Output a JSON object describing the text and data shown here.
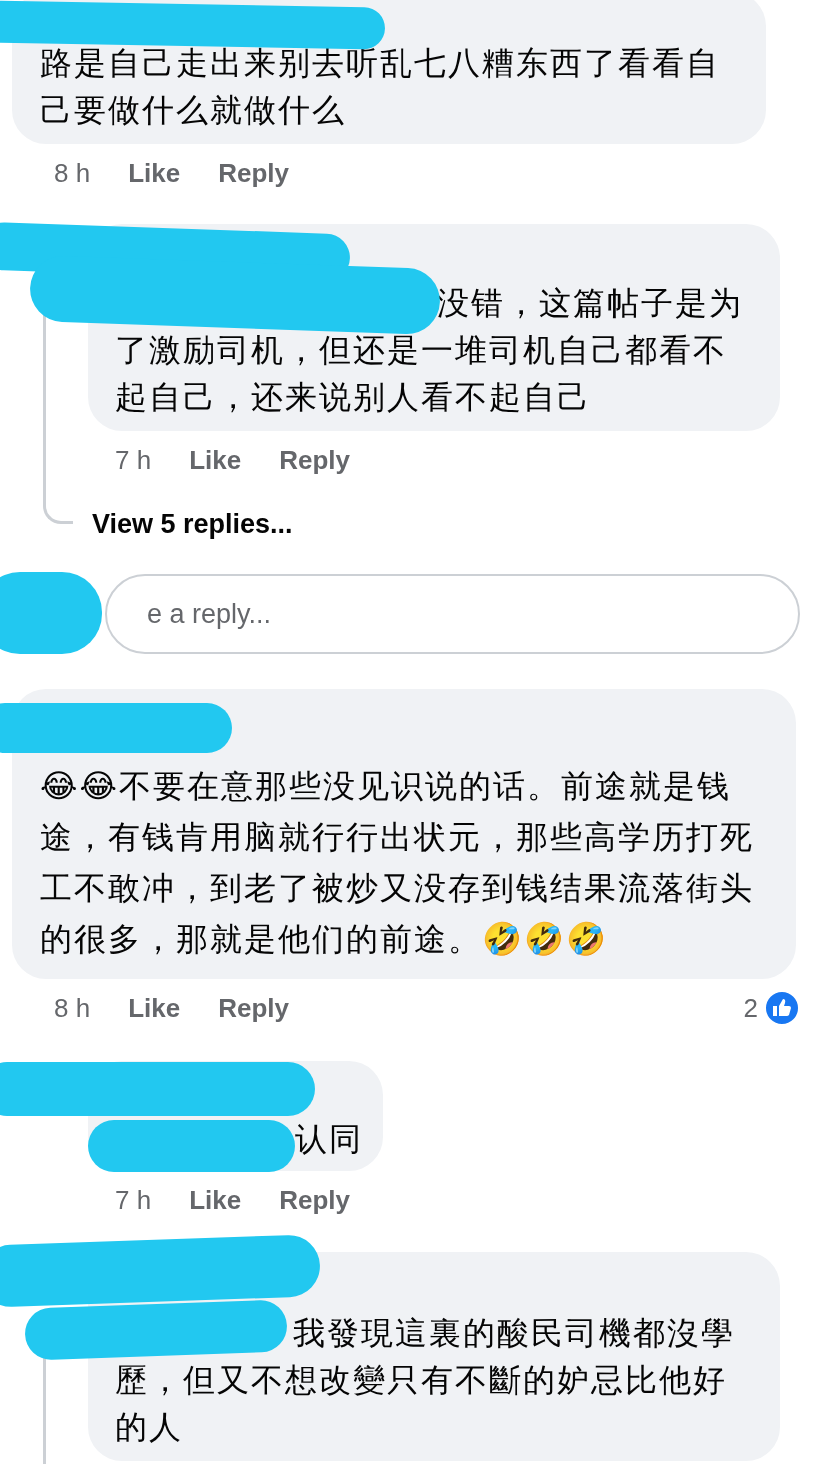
{
  "comments": [
    {
      "kind": "comment",
      "text": "路是自己走出来别去听乱七八糟东西了看看自己要做什么就做什么",
      "time": "8 h",
      "like": "Like",
      "reply": "Reply"
    },
    {
      "kind": "reply",
      "thread_line": true,
      "text": "没错，这篇帖子是为了激励司机，但还是一堆司机自己都看不起自己，还来说别人看不起自己",
      "time": "7 h",
      "like": "Like",
      "reply": "Reply"
    },
    {
      "kind": "more",
      "label": "View 5 replies..."
    },
    {
      "kind": "reply_field",
      "placeholder": "e a reply..."
    },
    {
      "kind": "comment",
      "text": "😂😂不要在意那些没见识说的话。前途就是钱途，有钱肯用脑就行行出状元，那些高学历打死工不敢冲，到老了被炒又没存到钱结果流落街头的很多，那就是他们的前途。🤣🤣🤣",
      "time": "8 h",
      "like": "Like",
      "reply": "Reply",
      "reaction_count": "2"
    },
    {
      "kind": "reply",
      "thread_line": false,
      "text": "认同",
      "time": "7 h",
      "like": "Like",
      "reply": "Reply"
    },
    {
      "kind": "reply",
      "thread_line": true,
      "text": "我發現這裏的酸民司機都沒學歷，但又不想改變只有不斷的妒忌比他好的人"
    }
  ]
}
